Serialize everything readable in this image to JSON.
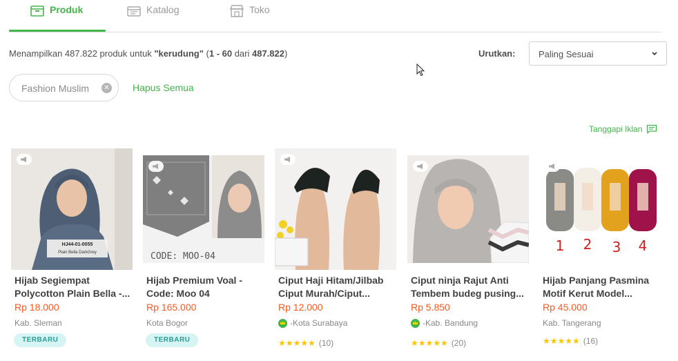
{
  "tabs": [
    {
      "label": "Produk",
      "icon": "product-box-icon",
      "active": true
    },
    {
      "label": "Katalog",
      "icon": "catalog-icon",
      "active": false
    },
    {
      "label": "Toko",
      "icon": "store-icon",
      "active": false
    }
  ],
  "summary": {
    "prefix": "Menampilkan 487.822 produk untuk ",
    "query": "\"kerudung\"",
    "range_open": " (",
    "range": "1 - 60",
    "range_mid": " dari ",
    "total": "487.822",
    "range_close": ")"
  },
  "sort": {
    "label": "Urutkan:",
    "value": "Paling Sesuai"
  },
  "filter_chip": {
    "label": "Fashion Muslim"
  },
  "clear_all": "Hapus Semua",
  "feedback": "Tanggapi Iklan",
  "colors": {
    "accent": "#42b549",
    "price": "#fa591d",
    "new_badge_bg": "#d6f4f3",
    "new_badge_text": "#2a9d97",
    "star": "#ffc400"
  },
  "products": [
    {
      "name": "Hijab Segiempat Polycotton Plain Bella -...",
      "price": "Rp 18.000",
      "location": "Kab. Sleman",
      "badge": "TERBARU",
      "image_label": "HJ44-01-0055",
      "image_sub": "Plain Bella DarkGrey"
    },
    {
      "name": "Hijab Premium Voal - Code: Moo 04",
      "price": "Rp 165.000",
      "location": "Kota Bogor",
      "badge": "TERBARU",
      "image_label": "CODE: MOO-04"
    },
    {
      "name": "Ciput Haji Hitam/Jilbab Ciput Murah/Ciput...",
      "price": "Rp 12.000",
      "location": "Kota Surabaya",
      "loc_prefix": "- ",
      "rating_count": "(10)",
      "stars": "★★★★★"
    },
    {
      "name": "Ciput ninja Rajut Anti Tembem budeg pusing...",
      "price": "Rp 5.850",
      "location": "Kab. Bandung",
      "loc_prefix": "- ",
      "rating_count": "(20)",
      "stars": "★★★★★"
    },
    {
      "name": "Hijab Panjang Pasmina Motif Kerut Model...",
      "price": "Rp 45.000",
      "location": "Kab. Tangerang",
      "rating_count": "(16)",
      "stars": "★★★★★",
      "image_numbers": [
        "1",
        "2",
        "3",
        "4"
      ]
    }
  ]
}
